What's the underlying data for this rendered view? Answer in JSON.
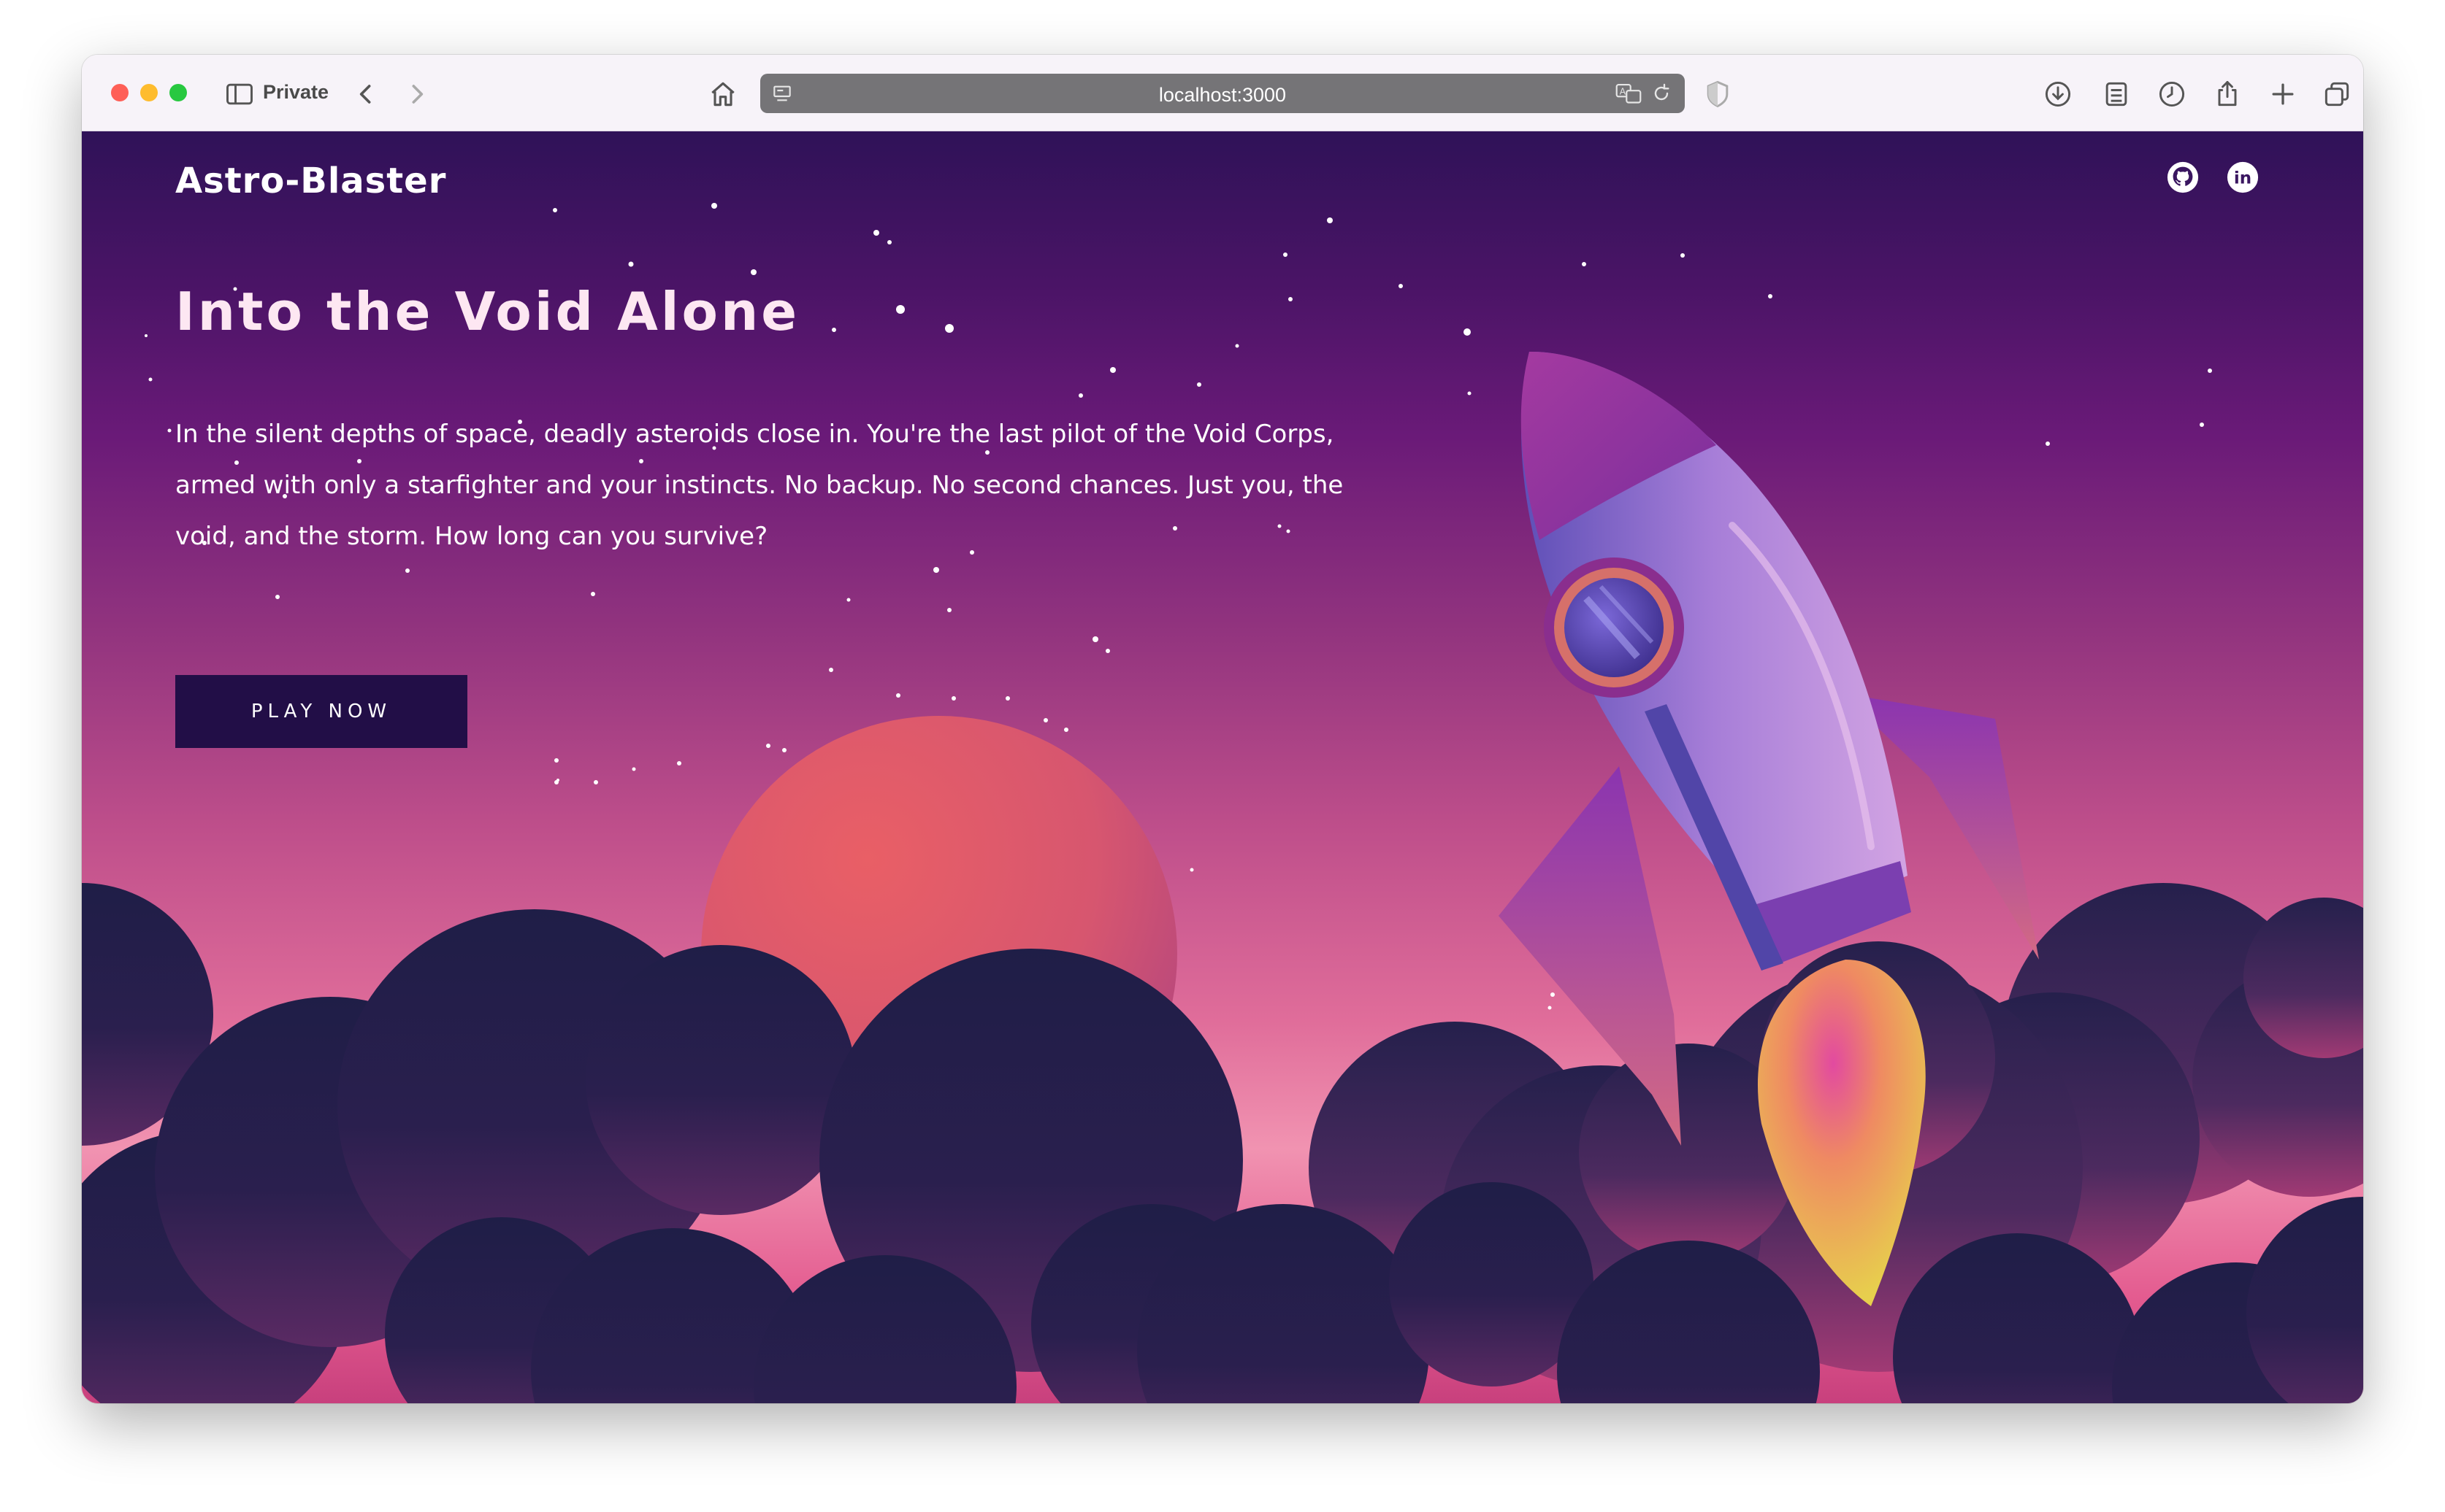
{
  "browser": {
    "mode_label": "Private",
    "url": "localhost:3000",
    "icons": [
      "sidebar-icon",
      "back-icon",
      "forward-icon",
      "home-icon",
      "page-menu-icon",
      "translate-icon",
      "reload-icon",
      "privacy-shield-icon",
      "downloads-icon",
      "reader-print-icon",
      "history-icon",
      "share-icon",
      "new-tab-icon",
      "tab-overview-icon"
    ]
  },
  "site": {
    "brand": "Astro-Blaster",
    "social": [
      "github-icon",
      "linkedin-icon"
    ],
    "hero": {
      "title": "Into the Void Alone",
      "description": "In the silent depths of space, deadly asteroids close in. You're the last pilot of the Void Corps, armed with only a starfighter and your instincts. No backup. No second chances. Just you, the void, and the storm. How long can you survive?",
      "cta": "PLAY NOW"
    }
  },
  "colors": {
    "sky_top": "#2f1258",
    "sky_mid": "#94357f",
    "sky_glow": "#f193b1",
    "cloud": "#1f1e47",
    "planet": "#e35d63",
    "rocket_body": "#a778d6",
    "flame": "#e7cf4d",
    "button_bg": "#220e47",
    "title_text": "#fde7f2"
  }
}
